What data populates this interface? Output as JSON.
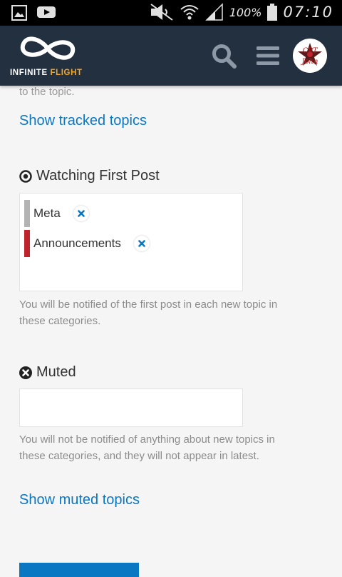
{
  "status_bar": {
    "left_icons": [
      "gallery-icon",
      "youtube-icon"
    ],
    "right_icons": [
      "mute-icon",
      "wifi-icon",
      "signal-icon",
      "battery-icon"
    ],
    "battery": "100%",
    "time": "07:10"
  },
  "header": {
    "logo_word1": "INFINITE",
    "logo_word2": "FLIGHT",
    "avatar_text_1": "CPT",
    "avatar_text_2": "John",
    "brand_accent": "#f5a623",
    "bg": "#233040"
  },
  "top_note": "to the topic.",
  "tracked": {
    "link": "Show tracked topics"
  },
  "watching_first_post": {
    "title": "Watching First Post",
    "categories": [
      {
        "name": "Meta",
        "color": "#b3b3b3"
      },
      {
        "name": "Announcements",
        "color": "#c0232c"
      }
    ],
    "description": "You will be notified of the first post in each new topic in these categories."
  },
  "muted": {
    "title": "Muted",
    "description": "You will not be notified of anything about new topics in these categories, and they will not appear in latest.",
    "link": "Show muted topics"
  },
  "colors": {
    "link": "#0a77c3",
    "muted_text": "#8c8c8c"
  }
}
